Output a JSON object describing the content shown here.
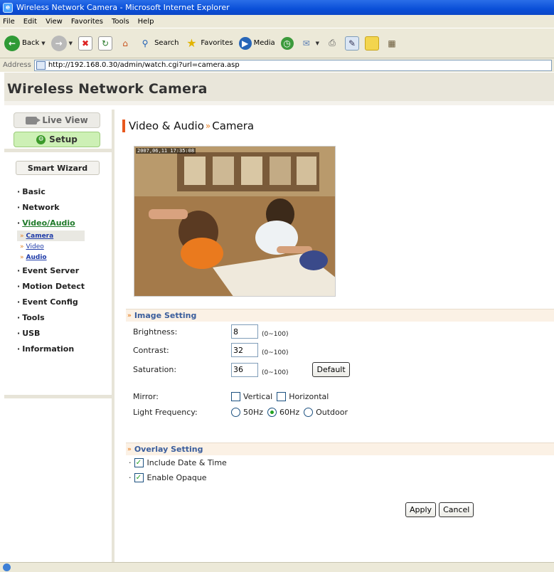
{
  "window": {
    "title": "Wireless Network Camera - Microsoft Internet Explorer"
  },
  "menu": [
    "File",
    "Edit",
    "View",
    "Favorites",
    "Tools",
    "Help"
  ],
  "toolbar": {
    "back": "Back",
    "search": "Search",
    "favorites": "Favorites",
    "media": "Media"
  },
  "address": {
    "label": "Address",
    "url": "http://192.168.0.30/admin/watch.cgi?url=camera.asp"
  },
  "header": {
    "title": "Wireless Network Camera"
  },
  "sidebar": {
    "live_view": "Live View",
    "setup": "Setup",
    "smart_wizard": "Smart Wizard",
    "nav": [
      {
        "label": "Basic"
      },
      {
        "label": "Network"
      },
      {
        "label": "Video/Audio"
      },
      {
        "label": "Event Server"
      },
      {
        "label": "Motion Detect"
      },
      {
        "label": "Event Config"
      },
      {
        "label": "Tools"
      },
      {
        "label": "USB"
      },
      {
        "label": "Information"
      }
    ],
    "video_audio_sub": [
      "Camera",
      "Video",
      "Audio"
    ]
  },
  "main": {
    "title_part1": "Video & Audio",
    "title_part2": "Camera",
    "osd_text": "2007,06,11 17:35:08",
    "image_setting": {
      "header": "Image Setting",
      "brightness_label": "Brightness:",
      "brightness": "8",
      "contrast_label": "Contrast:",
      "contrast": "32",
      "saturation_label": "Saturation:",
      "saturation": "36",
      "range": "(0~100)",
      "default_button": "Default",
      "mirror_label": "Mirror:",
      "mirror_vertical": "Vertical",
      "mirror_horizontal": "Horizontal",
      "light_label": "Light Frequency:",
      "light_options": [
        "50Hz",
        "60Hz",
        "Outdoor"
      ],
      "light_selected": "60Hz"
    },
    "overlay_setting": {
      "header": "Overlay Setting",
      "include_datetime": "Include Date & Time",
      "enable_opaque": "Enable Opaque"
    },
    "apply_button": "Apply",
    "cancel_button": "Cancel"
  },
  "colors": {
    "accent": "#e8581e",
    "nav_active": "#1f7a2a",
    "section_text": "#3a5d9c"
  }
}
